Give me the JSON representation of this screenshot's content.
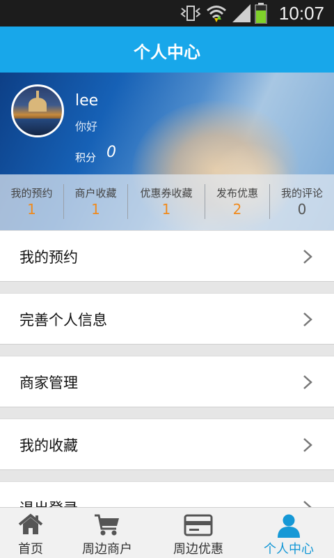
{
  "status_bar": {
    "time": "10:07"
  },
  "header": {
    "title": "个人中心"
  },
  "profile": {
    "username": "lee",
    "greeting": "你好",
    "points_label": "积分",
    "points_value": "0"
  },
  "stats": [
    {
      "label": "我的预约",
      "value": "1"
    },
    {
      "label": "商户收藏",
      "value": "1"
    },
    {
      "label": "优惠券收藏",
      "value": "1"
    },
    {
      "label": "发布优惠",
      "value": "2"
    },
    {
      "label": "我的评论",
      "value": "0"
    }
  ],
  "menu": [
    {
      "label": "我的预约"
    },
    {
      "label": "完善个人信息"
    },
    {
      "label": "商家管理"
    },
    {
      "label": "我的收藏"
    },
    {
      "label": "退出登录"
    }
  ],
  "bottom_nav": [
    {
      "label": "首页",
      "icon": "home-icon"
    },
    {
      "label": "周边商户",
      "icon": "cart-icon"
    },
    {
      "label": "周边优惠",
      "icon": "card-icon"
    },
    {
      "label": "个人中心",
      "icon": "person-icon",
      "active": true
    }
  ],
  "colors": {
    "accent": "#18a7ea",
    "stat_highlight": "#f08a1c",
    "nav_active": "#1598d6"
  }
}
